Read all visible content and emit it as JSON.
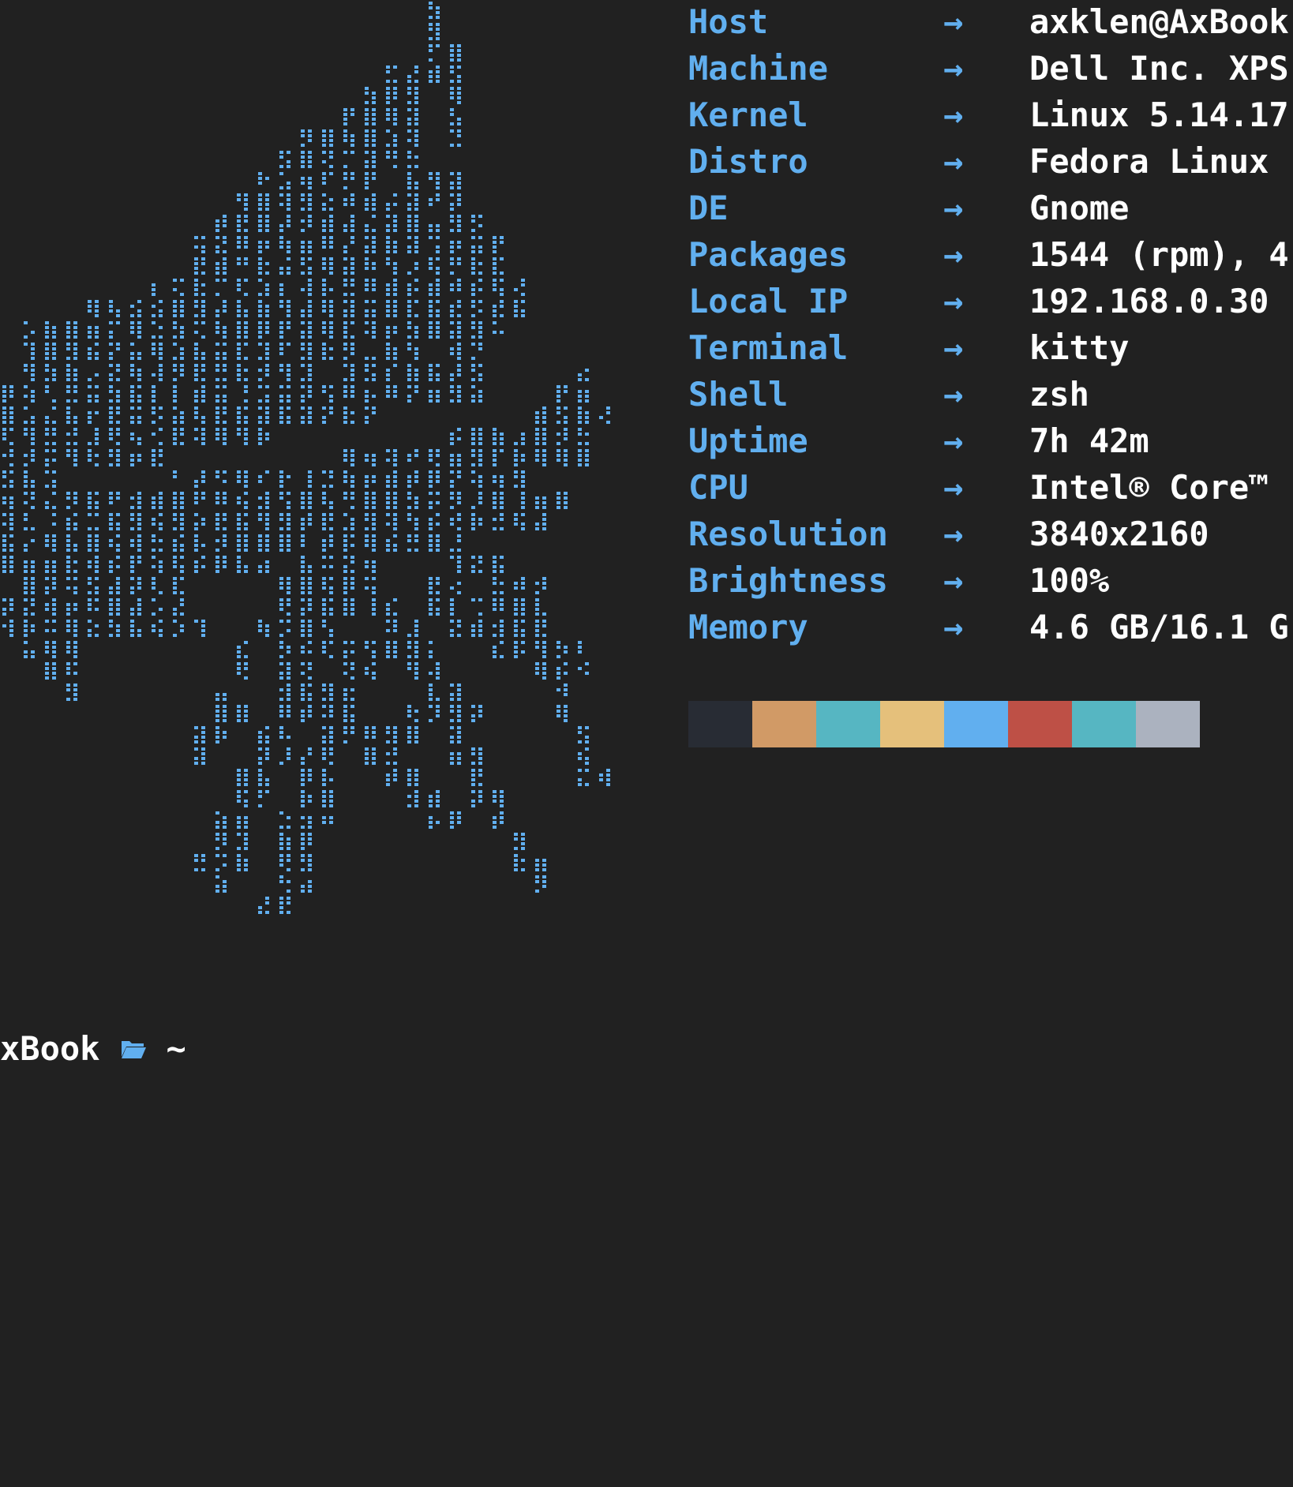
{
  "colors": {
    "background": "#212121",
    "accent": "#61afef",
    "text": "#ffffff"
  },
  "logo": {
    "description_icon": "ascii-braille-dragon-logo"
  },
  "info": [
    {
      "key": "Host",
      "arrow": "→",
      "value": "axklen@AxBook"
    },
    {
      "key": "Machine",
      "arrow": "→",
      "value": "Dell Inc. XPS"
    },
    {
      "key": "Kernel",
      "arrow": "→",
      "value": "Linux 5.14.17"
    },
    {
      "key": "Distro",
      "arrow": "→",
      "value": "Fedora Linux"
    },
    {
      "key": "DE",
      "arrow": "→",
      "value": "Gnome"
    },
    {
      "key": "Packages",
      "arrow": "→",
      "value": "1544 (rpm), 4"
    },
    {
      "key": "Local IP",
      "arrow": "→",
      "value": "192.168.0.30"
    },
    {
      "key": "Terminal",
      "arrow": "→",
      "value": "kitty"
    },
    {
      "key": "Shell",
      "arrow": "→",
      "value": "zsh"
    },
    {
      "key": "Uptime",
      "arrow": "→",
      "value": "7h 42m"
    },
    {
      "key": "CPU",
      "arrow": "→",
      "value": "Intel® Core™"
    },
    {
      "key": "Resolution",
      "arrow": "→",
      "value": "3840x2160"
    },
    {
      "key": "Brightness",
      "arrow": "→",
      "value": "100%"
    },
    {
      "key": "Memory",
      "arrow": "→",
      "value": "4.6 GB/16.1 G"
    }
  ],
  "palette": [
    "#282c34",
    "#d19a66",
    "#56b6c2",
    "#e5c07b",
    "#61afef",
    "#be5046",
    "#56b6c2",
    "#abb2bf"
  ],
  "prompt": {
    "host_fragment": "xBook",
    "folder_icon": "folder-open-icon",
    "cwd": "~"
  }
}
